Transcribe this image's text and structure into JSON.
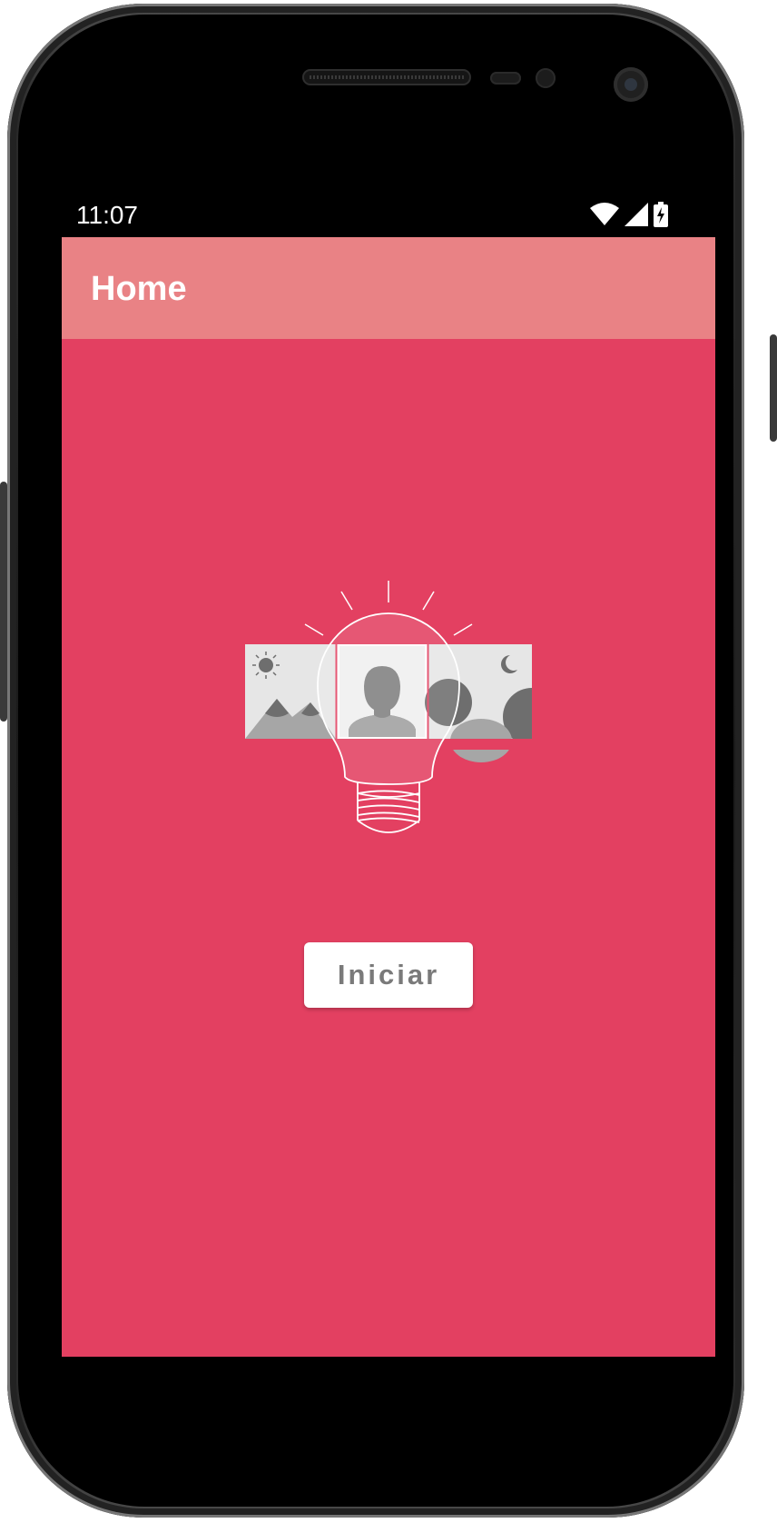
{
  "status_bar": {
    "time": "11:07",
    "icons": [
      "wifi-icon",
      "cell-signal-icon",
      "battery-charging-icon"
    ]
  },
  "app_bar": {
    "title": "Home"
  },
  "main": {
    "illustration": "lightbulb-with-photo-panels",
    "start_button_label": "Iniciar"
  },
  "colors": {
    "screen_background": "#e34061",
    "app_bar": "#e98285",
    "status_bar": "#000000",
    "button_text": "#7a7a7a"
  }
}
